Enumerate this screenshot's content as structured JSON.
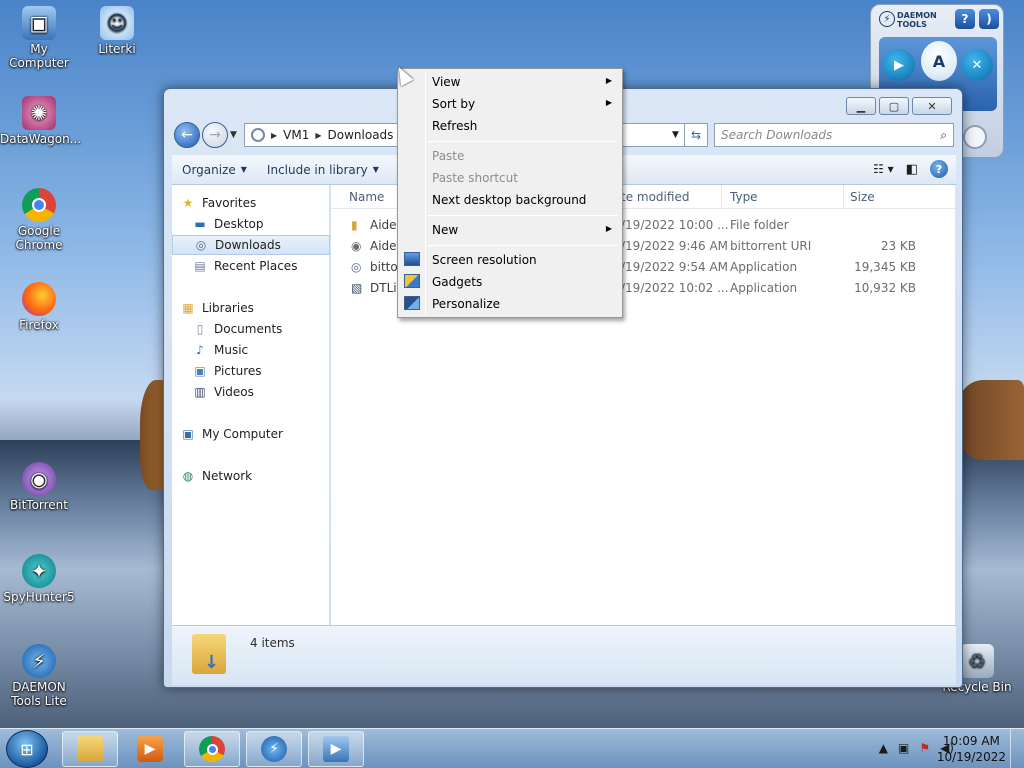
{
  "desktop": {
    "icons": [
      {
        "label": "My Computer",
        "icon": "computer-icon"
      },
      {
        "label": "Literki",
        "icon": "literki-icon"
      },
      {
        "label": "DataWagon...",
        "icon": "datawagon-icon"
      },
      {
        "label": "Google Chrome",
        "icon": "chrome-icon"
      },
      {
        "label": "Firefox",
        "icon": "firefox-icon"
      },
      {
        "label": "BitTorrent",
        "icon": "bittorrent-icon"
      },
      {
        "label": "SpyHunter5",
        "icon": "spyhunter-icon"
      },
      {
        "label": "DAEMON Tools Lite",
        "icon": "daemon-tools-icon"
      },
      {
        "label": "Recycle Bin",
        "icon": "recycle-bin-icon"
      }
    ]
  },
  "explorer": {
    "breadcrumb": [
      "VM1",
      "Downloads"
    ],
    "search_placeholder": "Search Downloads",
    "toolbar": {
      "organize": "Organize",
      "include_in_library": "Include in library"
    },
    "nav": {
      "favorites": "Favorites",
      "desktop": "Desktop",
      "downloads": "Downloads",
      "recent_places": "Recent Places",
      "libraries": "Libraries",
      "documents": "Documents",
      "music": "Music",
      "pictures": "Pictures",
      "videos": "Videos",
      "my_computer": "My Computer",
      "network": "Network"
    },
    "columns": {
      "name": "Name",
      "date_modified": "te modified",
      "type": "Type",
      "size": "Size"
    },
    "files": [
      {
        "name": "Aider",
        "date": "/19/2022 10:00 ...",
        "type": "File folder",
        "size": "",
        "icon": "folder-icon"
      },
      {
        "name": "Aider",
        "date": "/19/2022 9:46 AM",
        "type": "bittorrent URI",
        "size": "23 KB",
        "icon": "bittorrent-uri-icon"
      },
      {
        "name": "bitto",
        "date": "/19/2022 9:54 AM",
        "type": "Application",
        "size": "19,345 KB",
        "icon": "bittorrent-app-icon"
      },
      {
        "name": "DTLit",
        "date": "/19/2022 10:02 ...",
        "type": "Application",
        "size": "10,932 KB",
        "icon": "installer-icon"
      }
    ],
    "status": "4 items"
  },
  "daemon_gadget": {
    "title_line1": "DAEMON",
    "title_line2": "TOOLS",
    "help": "?"
  },
  "context_menu": {
    "items": [
      {
        "label": "View",
        "submenu": true,
        "disabled": false
      },
      {
        "label": "Sort by",
        "submenu": true,
        "disabled": false
      },
      {
        "label": "Refresh",
        "submenu": false,
        "disabled": false
      },
      {
        "label": "Paste",
        "submenu": false,
        "disabled": true
      },
      {
        "label": "Paste shortcut",
        "submenu": false,
        "disabled": true
      },
      {
        "label": "Next desktop background",
        "submenu": false,
        "disabled": false
      },
      {
        "label": "New",
        "submenu": true,
        "disabled": false
      },
      {
        "label": "Screen resolution",
        "submenu": false,
        "disabled": false,
        "icon": "screen-resolution-icon"
      },
      {
        "label": "Gadgets",
        "submenu": false,
        "disabled": false,
        "icon": "gadgets-icon"
      },
      {
        "label": "Personalize",
        "submenu": false,
        "disabled": false,
        "icon": "personalize-icon"
      }
    ]
  },
  "taskbar": {
    "clock_time": "10:09 AM",
    "clock_date": "10/19/2022",
    "tasks": [
      "explorer-icon",
      "media-player-icon",
      "chrome-icon",
      "daemon-tools-icon",
      "bittorrent-icon"
    ]
  }
}
